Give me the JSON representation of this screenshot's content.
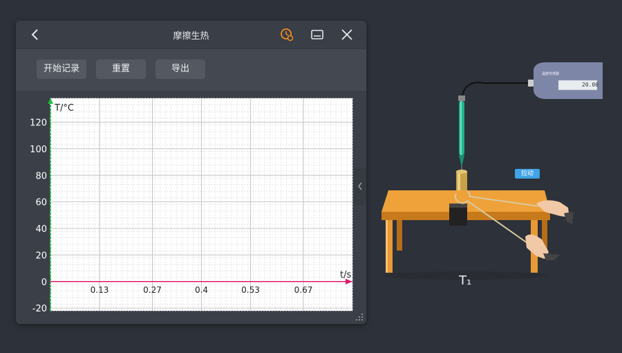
{
  "window": {
    "title": "摩擦生热",
    "back_icon": "chevron-left-icon",
    "timer_icon": "clock-settings-icon",
    "minimize_icon": "minimize-icon",
    "close_icon": "close-icon",
    "accent_color": "#f28c1c"
  },
  "toolbar": {
    "start_label": "开始记录",
    "reset_label": "重置",
    "export_label": "导出"
  },
  "chart_data": {
    "type": "line",
    "ylabel": "T/°C",
    "xlabel": "t/s",
    "yticks": [
      "120",
      "100",
      "80",
      "60",
      "40",
      "20",
      "0",
      "-20"
    ],
    "xticks": [
      "0.13",
      "0.27",
      "0.4",
      "0.53",
      "0.67"
    ],
    "ylim": [
      -22,
      138
    ],
    "xlim": [
      0,
      0.8
    ],
    "grid": true,
    "series": [
      {
        "x": [
          0,
          0.8
        ],
        "y": [
          0,
          0
        ],
        "color": "#e0196a"
      }
    ]
  },
  "scene": {
    "label": "T₁",
    "pull_button": "拉动",
    "sensor_reading": "20.00",
    "sensor_name": "温度传感器"
  }
}
